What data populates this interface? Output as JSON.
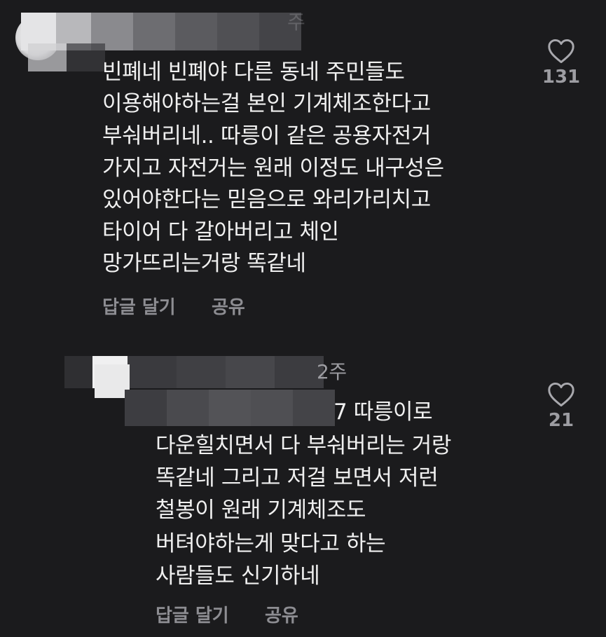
{
  "comments": [
    {
      "meta_visible": "주",
      "lines": [
        "빈폐네 빈폐야 다른 동네 주민들도",
        "이용해야하는걸 본인 기계체조한다고",
        "부숴버리네.. 따릉이 같은 공용자전거",
        "가지고 자전거는 원래 이정도 내구성은",
        "있어야한다는 믿음으로 와리가리치고",
        "타이어 다 갈아버리고 체인",
        "망가뜨리는거랑 똑같네"
      ],
      "reply_label": "답글 달기",
      "share_label": "공유",
      "like_count": "131",
      "like_icon": "heart-outline-icon"
    },
    {
      "meta_visible": "2주",
      "lines": [
        "7 따릉이로",
        "다운힐치면서 다 부숴버리는 거랑",
        "똑같네 그리고 저걸 보면서 저런",
        "철봉이 원래 기계체조도",
        "버텨야하는게 맞다고 하는",
        "사람들도 신기하네"
      ],
      "reply_label": "답글 달기",
      "share_label": "공유",
      "like_count": "21",
      "like_icon": "heart-outline-icon"
    }
  ],
  "colors": {
    "background": "#1b1b1d",
    "text": "#f0f0f0",
    "muted": "#9d9da2",
    "censor_light": "#e9e9ea",
    "censor_dark": "#3a3a3d"
  }
}
